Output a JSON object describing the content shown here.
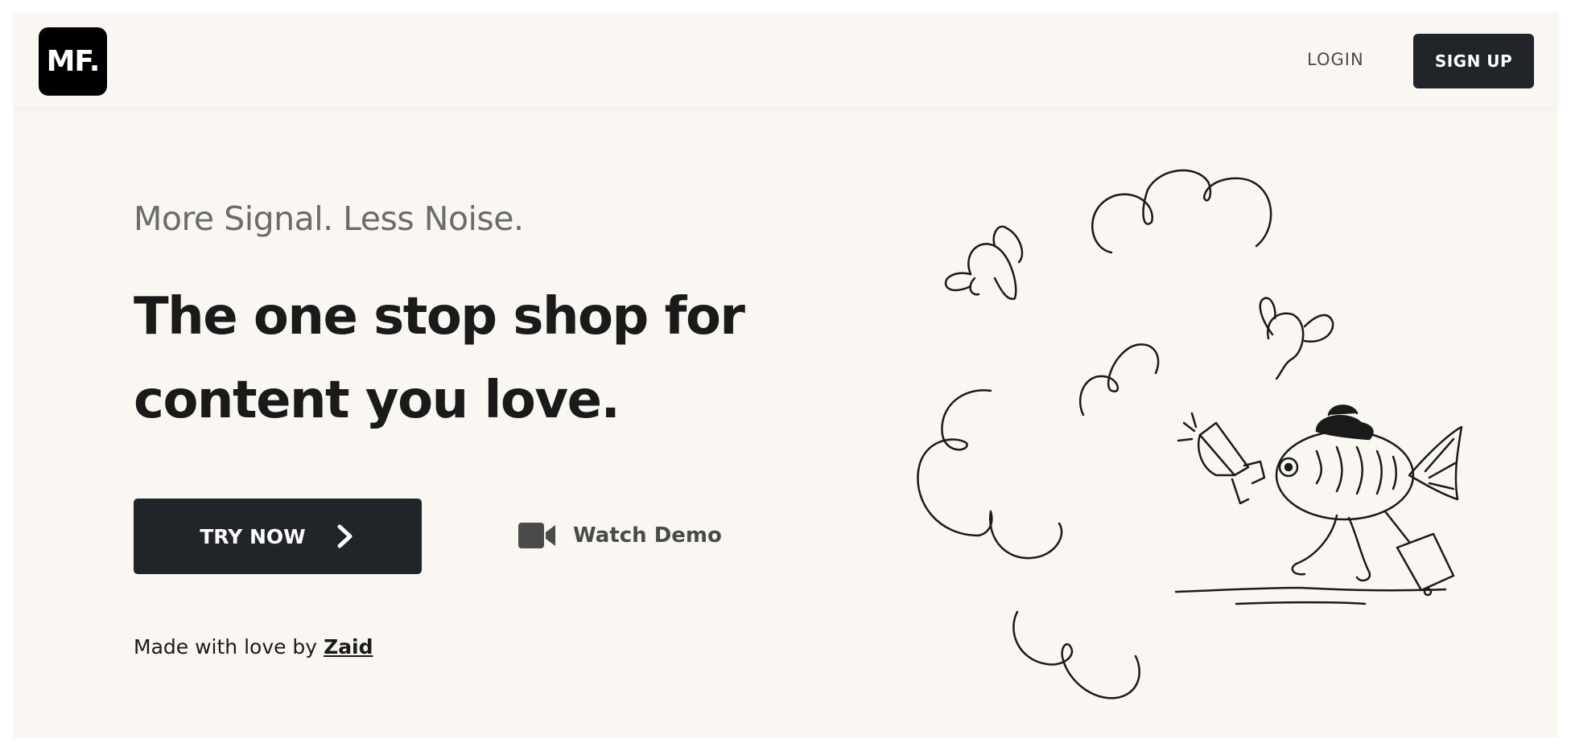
{
  "navbar": {
    "logo_text": "MF.",
    "login_label": "LOGIN",
    "signup_label": "SIGN UP"
  },
  "hero": {
    "tagline": "More Signal. Less Noise.",
    "headline_line1": "The one stop shop for",
    "headline_line2": "content you love.",
    "try_now_label": "TRY NOW",
    "watch_demo_label": "Watch Demo",
    "credit_prefix": "Made with love by ",
    "credit_name": "Zaid"
  },
  "icons": {
    "try_now_icon": "chevron-right-icon",
    "watch_demo_icon": "video-camera-icon"
  },
  "colors": {
    "background": "#faf7f3",
    "button_dark": "#212428",
    "text_dark": "#1a1a1a",
    "text_muted": "#6b6b6b"
  }
}
